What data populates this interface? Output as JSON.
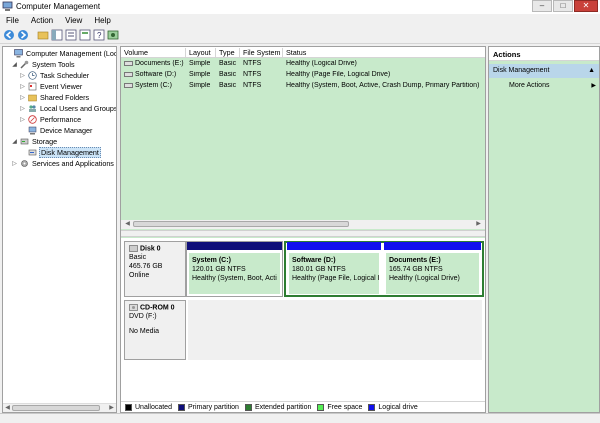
{
  "window": {
    "title": "Computer Management",
    "minimize": "–",
    "maximize": "□",
    "close": "✕"
  },
  "menu": [
    "File",
    "Action",
    "View",
    "Help"
  ],
  "tree": [
    {
      "label": "Computer Management (Local",
      "level": 0,
      "expander": "",
      "icon": "computer-icon"
    },
    {
      "label": "System Tools",
      "level": 1,
      "expander": "◢",
      "icon": "tools-icon"
    },
    {
      "label": "Task Scheduler",
      "level": 2,
      "expander": "▷",
      "icon": "clock-icon"
    },
    {
      "label": "Event Viewer",
      "level": 2,
      "expander": "▷",
      "icon": "event-icon"
    },
    {
      "label": "Shared Folders",
      "level": 2,
      "expander": "▷",
      "icon": "folder-icon"
    },
    {
      "label": "Local Users and Groups",
      "level": 2,
      "expander": "▷",
      "icon": "users-icon"
    },
    {
      "label": "Performance",
      "level": 2,
      "expander": "▷",
      "icon": "performance-icon"
    },
    {
      "label": "Device Manager",
      "level": 2,
      "expander": "",
      "icon": "device-icon"
    },
    {
      "label": "Storage",
      "level": 1,
      "expander": "◢",
      "icon": "storage-icon"
    },
    {
      "label": "Disk Management",
      "level": 2,
      "expander": "",
      "icon": "disk-icon",
      "selected": true
    },
    {
      "label": "Services and Applications",
      "level": 1,
      "expander": "▷",
      "icon": "services-icon"
    }
  ],
  "volumes": {
    "columns": [
      "Volume",
      "Layout",
      "Type",
      "File System",
      "Status"
    ],
    "rows": [
      {
        "volume": "Documents (E:)",
        "layout": "Simple",
        "type": "Basic",
        "fs": "NTFS",
        "status": "Healthy (Logical Drive)"
      },
      {
        "volume": "Software (D:)",
        "layout": "Simple",
        "type": "Basic",
        "fs": "NTFS",
        "status": "Healthy (Page File, Logical Drive)"
      },
      {
        "volume": "System (C:)",
        "layout": "Simple",
        "type": "Basic",
        "fs": "NTFS",
        "status": "Healthy (System, Boot, Active, Crash Dump, Primary Partition)"
      }
    ]
  },
  "disks": [
    {
      "name": "Disk 0",
      "kind": "Basic",
      "size": "465.76 GB",
      "state": "Online",
      "partitions": [
        {
          "name": "System  (C:)",
          "size": "120.01 GB NTFS",
          "status": "Healthy (System, Boot, Acti",
          "bar_color": "#0f0f7a"
        },
        {
          "name": "Software  (D:)",
          "size": "180.01 GB NTFS",
          "status": "Healthy (Page File, Logical I",
          "bar_color": "#1010ee"
        },
        {
          "name": "Documents  (E:)",
          "size": "165.74 GB NTFS",
          "status": "Healthy (Logical Drive)",
          "bar_color": "#1010ee"
        }
      ]
    },
    {
      "name": "CD-ROM 0",
      "kind": "DVD (F:)",
      "state": "No Media"
    }
  ],
  "legend": [
    {
      "label": "Unallocated",
      "color": "#000000"
    },
    {
      "label": "Primary partition",
      "color": "#0f0f7a"
    },
    {
      "label": "Extended partition",
      "color": "#2e7d32"
    },
    {
      "label": "Free space",
      "color": "#55ee55"
    },
    {
      "label": "Logical drive",
      "color": "#1010ee"
    }
  ],
  "actions": {
    "title": "Actions",
    "section": "Disk Management",
    "section_caret": "▲",
    "items": [
      {
        "label": "More Actions",
        "arrow": "▶"
      }
    ]
  },
  "scroll": {
    "left": "◀",
    "right": "▶"
  }
}
